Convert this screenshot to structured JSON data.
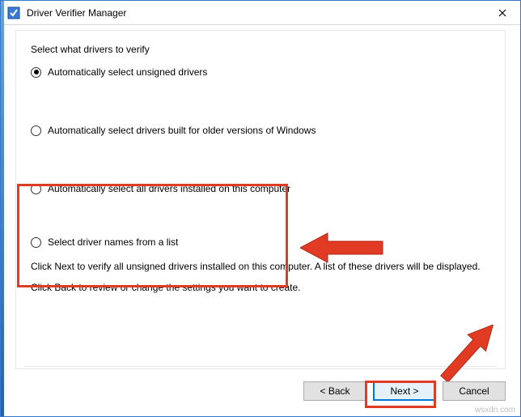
{
  "window": {
    "title": "Driver Verifier Manager",
    "close_tooltip": "Close"
  },
  "prompt": "Select what drivers to verify",
  "options": [
    {
      "label": "Automatically select unsigned drivers",
      "checked": true
    },
    {
      "label": "Automatically select drivers built for older versions of Windows",
      "checked": false
    },
    {
      "label": "Automatically select all drivers installed on this computer",
      "checked": false
    },
    {
      "label": "Select driver names from a list",
      "checked": false
    }
  ],
  "hints": {
    "line1": "Click Next to verify all unsigned drivers installed on this computer. A list of these drivers will be displayed.",
    "line2": "Click Back to review or change the settings you want to create."
  },
  "buttons": {
    "back": "< Back",
    "next": "Next >",
    "cancel": "Cancel"
  },
  "watermark": "wsxdn.com"
}
